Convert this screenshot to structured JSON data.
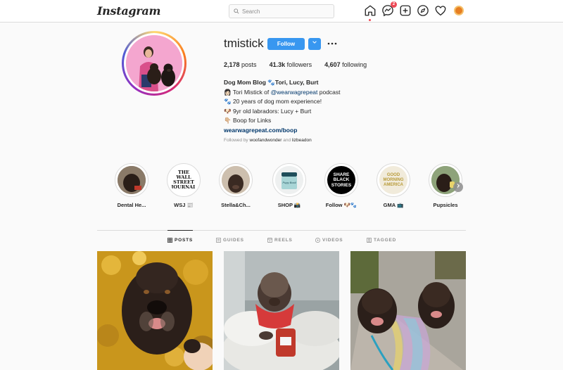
{
  "nav": {
    "logo": "Instagram",
    "search_placeholder": "Search",
    "messenger_badge": "2"
  },
  "profile": {
    "username": "tmistick",
    "follow_label": "Follow",
    "stats": {
      "posts_count": "2,178",
      "posts_label": "posts",
      "followers_count": "41.3k",
      "followers_label": "followers",
      "following_count": "4,607",
      "following_label": "following"
    },
    "bio": {
      "name": "Dog Mom Blog 🐾Tori, Lucy, Burt",
      "line1_prefix": "👩🏻 Tori Mistick of ",
      "line1_mention": "@wearwagrepeat",
      "line1_suffix": " podcast",
      "line2": "🐾 20 years of dog mom experience!",
      "line3": "🐶 9yr old labradors: Lucy + Burt",
      "line4": "👇🏼 Boop for Links",
      "link": "wearwagrepeat.com/boop"
    },
    "followed_by_prefix": "Followed by ",
    "followed_by_user1": "woofandwonder",
    "followed_by_and": " and ",
    "followed_by_user2": "lizbeadon"
  },
  "highlights": [
    {
      "label": "Dental He..."
    },
    {
      "label": "WSJ 📰"
    },
    {
      "label": "Stella&Ch..."
    },
    {
      "label": "SHOP 📸"
    },
    {
      "label": "Follow 🐶🐾"
    },
    {
      "label": "GMA 📺"
    },
    {
      "label": "Pupsicles"
    }
  ],
  "highlight_texts": {
    "wsj": "THE WALL STREET JOURNAL",
    "share": "SHARE BLACK STORIES",
    "gma": "GOOD MORNING AMERICA",
    "jar": "Pupy Booli"
  },
  "tabs": [
    {
      "label": "POSTS",
      "icon": "grid-icon",
      "active": true
    },
    {
      "label": "GUIDES",
      "icon": "guide-icon",
      "active": false
    },
    {
      "label": "REELS",
      "icon": "reels-icon",
      "active": false
    },
    {
      "label": "VIDEOS",
      "icon": "video-icon",
      "active": false
    },
    {
      "label": "TAGGED",
      "icon": "tag-icon",
      "active": false
    }
  ]
}
